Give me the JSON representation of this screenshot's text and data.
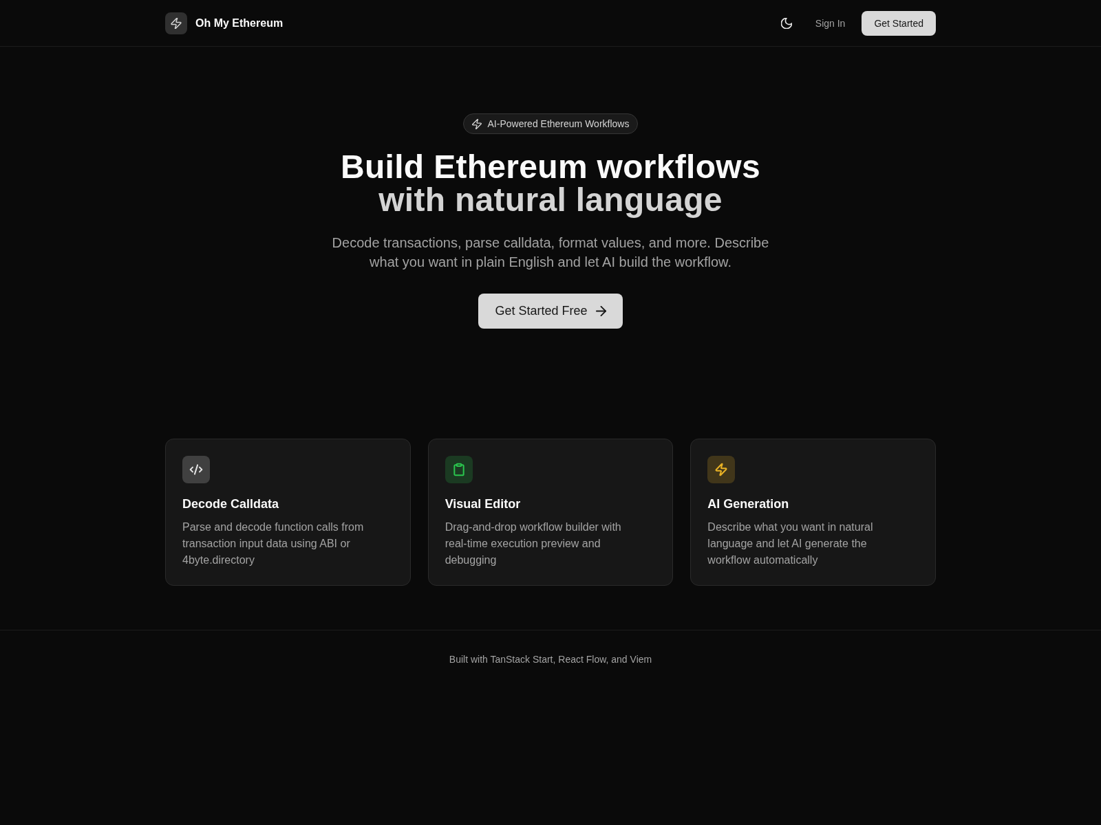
{
  "header": {
    "brand": "Oh My Ethereum",
    "sign_in": "Sign In",
    "get_started": "Get Started"
  },
  "hero": {
    "badge": "AI-Powered Ethereum Workflows",
    "headline": "Build Ethereum workflows",
    "headline_accent": "with natural language",
    "description": "Decode transactions, parse calldata, format values, and more. Describe what you want in plain English and let AI build the workflow.",
    "cta": "Get Started Free"
  },
  "features": [
    {
      "kind": "code",
      "color": "#404040",
      "title": "Decode Calldata",
      "description": "Parse and decode function calls from transaction input data using ABI or 4byte.directory"
    },
    {
      "kind": "clipboard",
      "color": "#1b3a22",
      "title": "Visual Editor",
      "description": "Drag-and-drop workflow builder with real-time execution preview and debugging"
    },
    {
      "kind": "bolt",
      "color": "#41361a",
      "title": "AI Generation",
      "description": "Describe what you want in natural language and let AI generate the workflow automatically"
    }
  ],
  "footer": {
    "text": "Built with TanStack Start, React Flow, and Viem"
  }
}
